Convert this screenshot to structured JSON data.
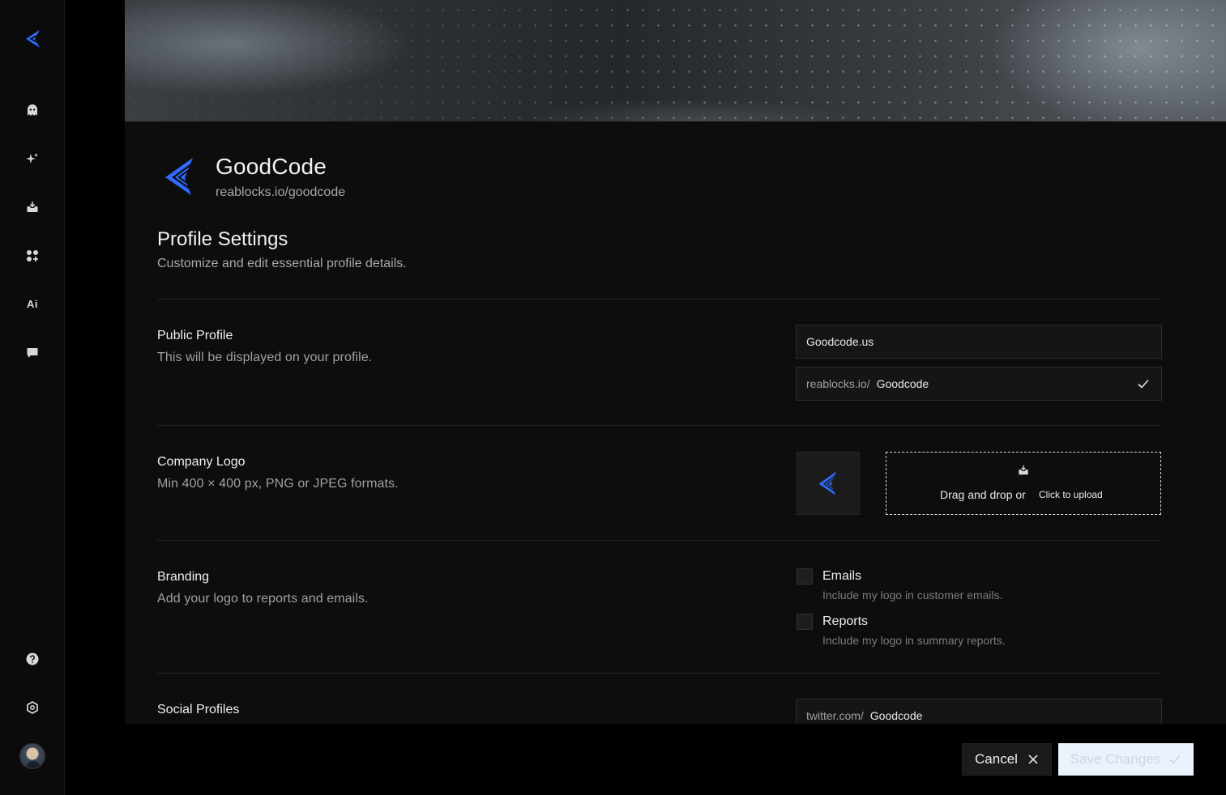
{
  "colors": {
    "accent": "#2f6bff",
    "background": "#0d0d0d",
    "sidebar": "#0b0b0b",
    "save_button_bg": "#eaf2fc"
  },
  "sidebar": {
    "logo_icon": "chevron-logo-icon",
    "items": [
      {
        "icon": "ghost-icon"
      },
      {
        "icon": "sparkles-icon"
      },
      {
        "icon": "inbox-download-icon"
      },
      {
        "icon": "apps-add-icon"
      },
      {
        "icon": "ai-text-icon",
        "label": "Ai"
      },
      {
        "icon": "chat-bubble-icon"
      }
    ],
    "bottom_items": [
      {
        "icon": "help-icon"
      },
      {
        "icon": "settings-icon"
      },
      {
        "icon": "avatar"
      }
    ]
  },
  "brand": {
    "name": "GoodCode",
    "url": "reablocks.io/goodcode"
  },
  "page": {
    "title": "Profile Settings",
    "subtitle": "Customize and edit essential profile details."
  },
  "public_profile": {
    "title": "Public Profile",
    "description": "This will be displayed on your profile.",
    "name_value": "Goodcode.us",
    "url_prefix": "reablocks.io/",
    "url_value": "Goodcode"
  },
  "company_logo": {
    "title": "Company Logo",
    "description": "Min 400 × 400 px, PNG or JPEG formats.",
    "drop_text": "Drag and drop or",
    "drop_link": "Click to upload"
  },
  "branding": {
    "title": "Branding",
    "description": "Add your logo to reports and emails.",
    "options": [
      {
        "label": "Emails",
        "hint": "Include my logo in customer emails.",
        "checked": false
      },
      {
        "label": "Reports",
        "hint": "Include my logo in summary reports.",
        "checked": false
      }
    ]
  },
  "social": {
    "title": "Social Profiles",
    "twitter_prefix": "twitter.com/",
    "twitter_value": "Goodcode"
  },
  "footer": {
    "cancel_label": "Cancel",
    "save_label": "Save Changes"
  }
}
